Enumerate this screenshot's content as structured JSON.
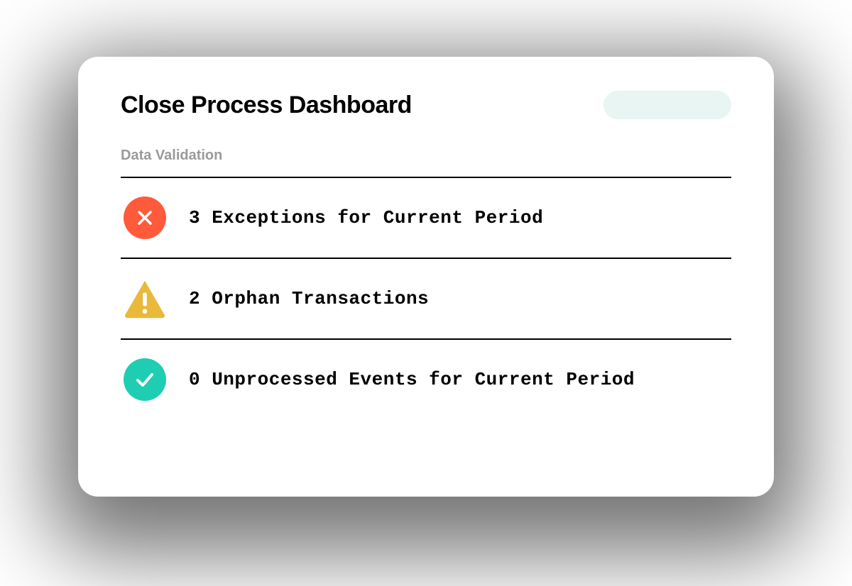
{
  "header": {
    "title": "Close Process Dashboard"
  },
  "section": {
    "label": "Data Validation"
  },
  "items": [
    {
      "status": "error",
      "icon": "x-icon",
      "text": "3 Exceptions for Current Period"
    },
    {
      "status": "warning",
      "icon": "alert-icon",
      "text": "2 Orphan Transactions"
    },
    {
      "status": "success",
      "icon": "check-icon",
      "text": "0 Unprocessed Events for Current Period"
    }
  ],
  "colors": {
    "error": "#ff5a3c",
    "warning": "#e8b93a",
    "success": "#1fceb2",
    "pill": "#e8f5f2"
  }
}
